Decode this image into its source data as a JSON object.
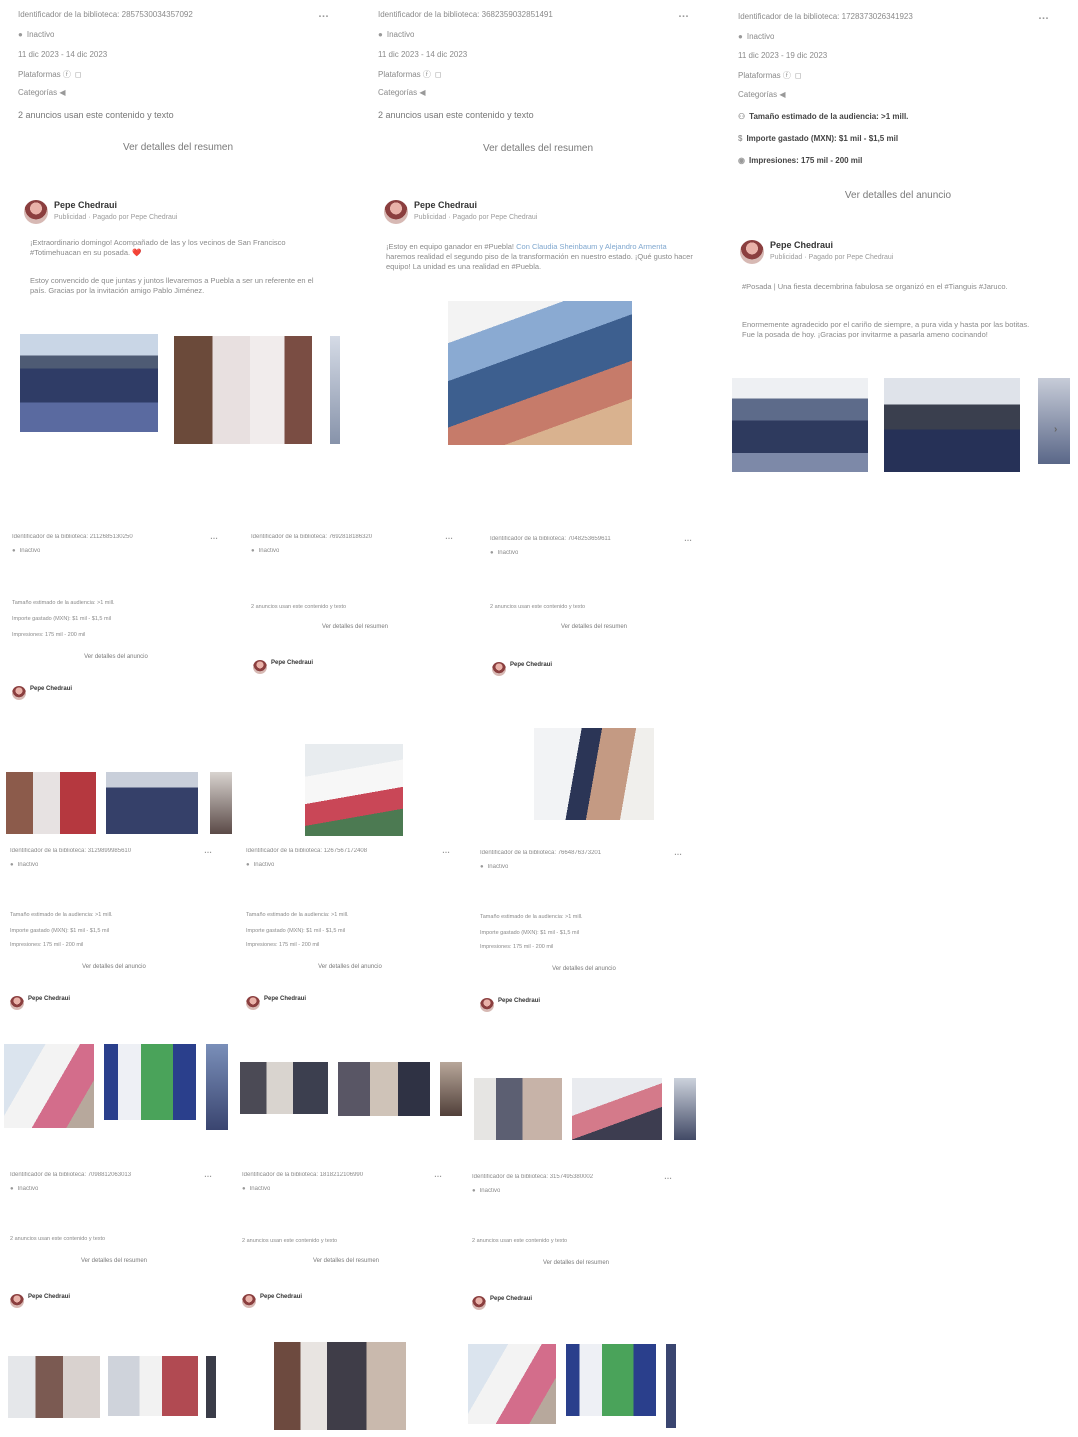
{
  "common": {
    "more": "…",
    "platforms_label": "Plataformas",
    "category_label": "Categorías",
    "uses_label": "2 anuncios usan este contenido y texto",
    "summary_link": "Ver detalles del resumen",
    "ad_link": "Ver detalles del anuncio",
    "advertiser": "Pepe Chedraui",
    "sponsor": "Publicidad · Pagado por Pepe Chedraui",
    "audience": "Tamaño estimado de la audiencia: >1 mill.",
    "spend": "Importe gastado (MXN): $1 mil - $1,5 mil",
    "impressions": "Impresiones: 175 mil - 200 mil"
  },
  "cards_top": [
    {
      "id": "Identificador de la biblioteca: 2857530034357092",
      "status": "Inactivo",
      "dates": "11 dic 2023 - 14 dic 2023",
      "summary": true,
      "body1": "¡Extraordinario domingo! Acompañado de las y los vecinos de San Francisco #Totimehuacan en su posada. ❤️",
      "body2": "Estoy convencido de que juntas y juntos llevaremos a Puebla a ser un referente en el país. Gracias por la invitación amigo Pablo Jiménez."
    },
    {
      "id": "Identificador de la biblioteca: 3682359032851491",
      "status": "Inactivo",
      "dates": "11 dic 2023 - 14 dic 2023",
      "summary": true,
      "body1a": "¡Estoy en equipo ganador en #Puebla! ",
      "body1b": "Con Claudia Sheinbaum y Alejandro Armenta",
      "body1c": " haremos realidad el segundo piso de la transformación en nuestro estado. ¡Qué gusto hacer equipo! La unidad es una realidad en #Puebla."
    },
    {
      "id": "Identificador de la biblioteca: 1728373026341923",
      "status": "Inactivo",
      "dates": "11 dic 2023 - 19 dic 2023",
      "summary": false,
      "body1": "#Posada | Una fiesta decembrina fabulosa se organizó en el #Tianguis #Jaruco.",
      "body2": "Enormemente agradecido por el cariño de siempre, a pura vida y hasta por las botitas. Fue la posada de hoy. ¡Gracias por invitarme a pasarla ameno cocinando!"
    }
  ],
  "small_rows": [
    [
      "Identificador de la biblioteca: 2112685130250",
      "Identificador de la biblioteca: 7692818186320",
      "Identificador de la biblioteca: 7048253659611"
    ],
    [
      "Identificador de la biblioteca: 3129899985610",
      "Identificador de la biblioteca: 1267567172408",
      "Identificador de la biblioteca: 7664876373201"
    ],
    [
      "Identificador de la biblioteca: 7098812063013",
      "Identificador de la biblioteca: 1818212106990",
      "Identificador de la biblioteca: 3157495380002"
    ]
  ]
}
